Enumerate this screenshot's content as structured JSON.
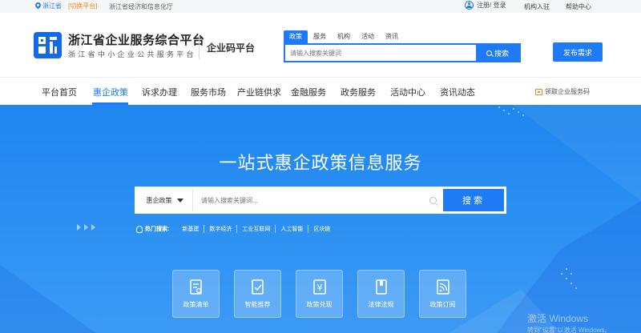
{
  "topbar": {
    "location": "浙江省",
    "switch_label": "[切换平台]",
    "department": "浙江省经济和信息化厅",
    "login_register": "注册/ 登录",
    "join": "机构入驻",
    "help": "帮助中心"
  },
  "brand": {
    "title": "浙江省企业服务综合平台",
    "subtitle": "浙江省中小企业公共服务平台",
    "code_platform": "企业码平台"
  },
  "header_search": {
    "tabs": [
      "政策",
      "服务",
      "机构",
      "活动",
      "资讯"
    ],
    "active_tab": 0,
    "placeholder": "请输入搜索关键词",
    "button": "搜索"
  },
  "publish_button": "发布需求",
  "nav": {
    "items": [
      "平台首页",
      "惠企政策",
      "诉求办理",
      "服务市场",
      "产业链供求",
      "金融服务",
      "政务服务",
      "活动中心",
      "资讯动态"
    ],
    "active": 1,
    "code_link": "领取企业服务码"
  },
  "banner": {
    "title": "一站式惠企政策信息服务",
    "category": "惠企政策",
    "placeholder": "请输入搜索关键词...",
    "button": "搜索",
    "hot_label": "热门搜索:",
    "hot_keywords": [
      "新基建",
      "数字经济",
      "工业互联网",
      "人工智能",
      "区块链"
    ]
  },
  "tiles": [
    {
      "label": "政策清单",
      "icon": "policy-list-icon"
    },
    {
      "label": "智能推荐",
      "icon": "smart-recommend-icon"
    },
    {
      "label": "政策兑现",
      "icon": "policy-cash-icon"
    },
    {
      "label": "法律法规",
      "icon": "law-book-icon"
    },
    {
      "label": "政策订阅",
      "icon": "subscribe-rss-icon"
    }
  ],
  "watermark": {
    "line1": "激活 Windows",
    "line2": "转到\"设置\"以激活 Windows。"
  },
  "colors": {
    "primary": "#1f7bf5",
    "accent_orange": "#f08a18",
    "banner": "#2a8ff3"
  }
}
